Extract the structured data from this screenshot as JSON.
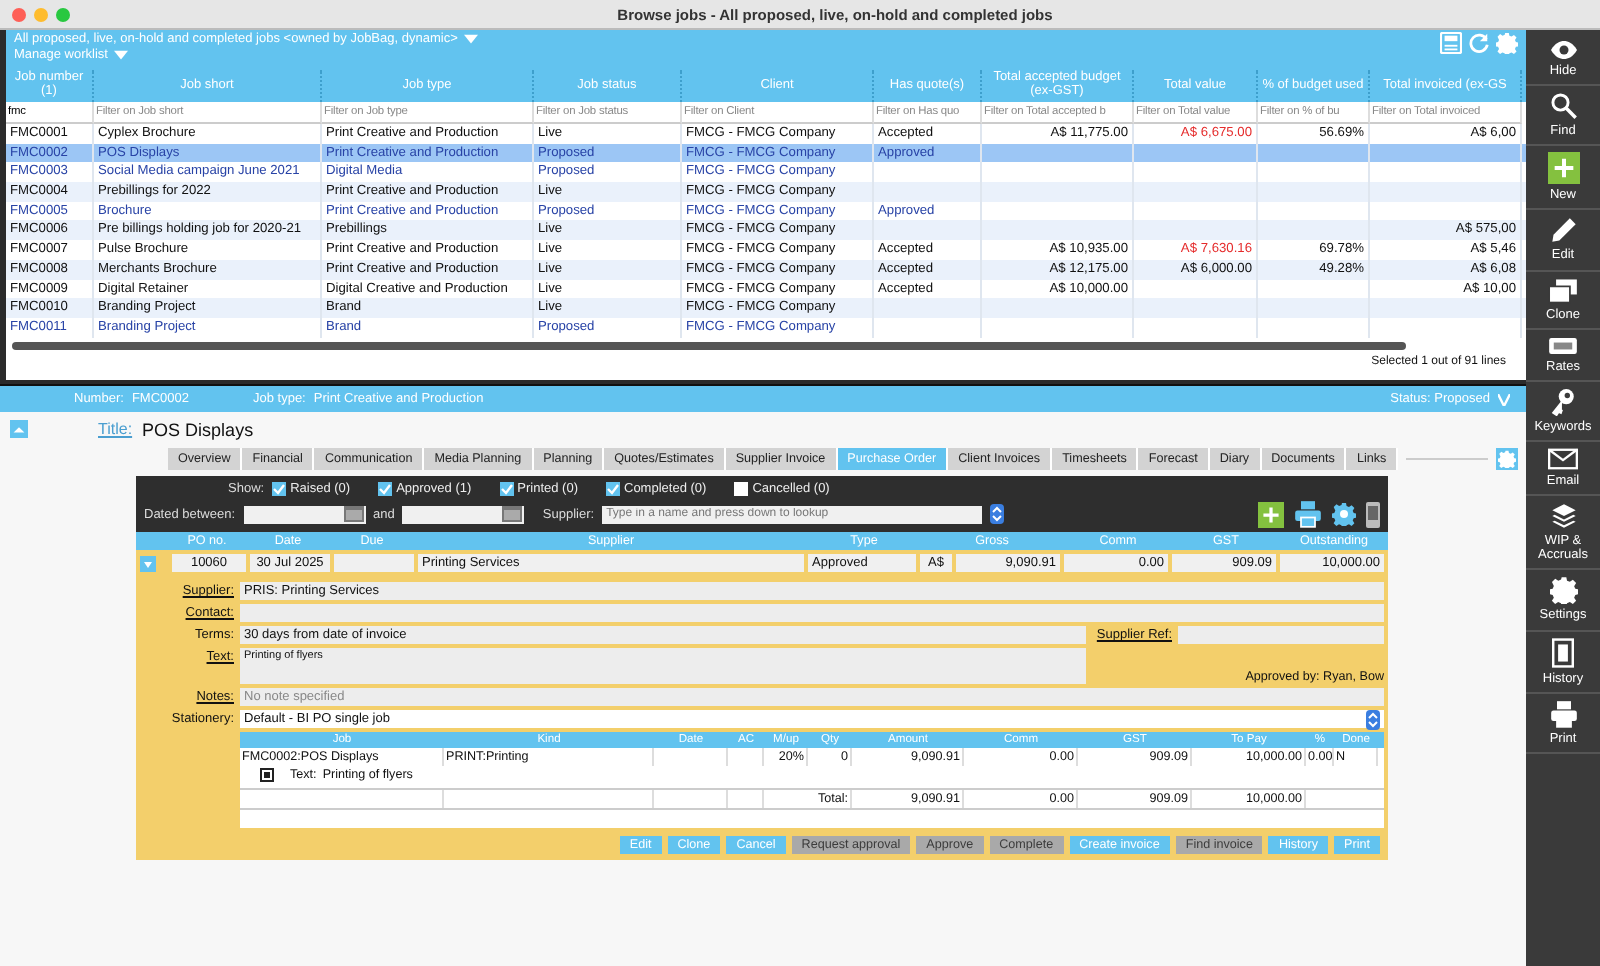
{
  "window": {
    "title": "Browse jobs - All proposed, live, on-hold and completed jobs"
  },
  "job_list": {
    "filter_title": "All proposed, live, on-hold and completed jobs <owned by JobBag, dynamic>",
    "manage_label": "Manage worklist",
    "columns": [
      "Job number (1)",
      "Job short",
      "Job type",
      "Job status",
      "Client",
      "Has quote(s)",
      "Total accepted budget (ex-GST)",
      "Total value",
      "% of budget used",
      "Total invoiced (ex-GS"
    ],
    "filters": [
      {
        "value": "fmc"
      },
      {
        "placeholder": "Filter on Job short"
      },
      {
        "placeholder": "Filter on Job type"
      },
      {
        "placeholder": "Filter on Job status"
      },
      {
        "placeholder": "Filter on Client"
      },
      {
        "placeholder": "Filter on Has quo"
      },
      {
        "placeholder": "Filter on Total accepted b"
      },
      {
        "placeholder": "Filter on Total value"
      },
      {
        "placeholder": "Filter on % of bu"
      },
      {
        "placeholder": "Filter on Total invoiced"
      }
    ],
    "rows": [
      {
        "kind": "live",
        "selected": false,
        "over_budget": true,
        "number": "FMC0001",
        "short": "Cyplex Brochure",
        "type": "Print Creative and Production",
        "status": "Live",
        "client": "FMCG - FMCG Company",
        "quote": "Accepted",
        "budget": "A$ 11,775.00",
        "value": "A$ 6,675.00",
        "pct": "56.69%",
        "invoiced": "A$ 6,00"
      },
      {
        "kind": "proposed",
        "selected": true,
        "number": "FMC0002",
        "short": "POS Displays",
        "type": "Print Creative and Production",
        "status": "Proposed",
        "client": "FMCG - FMCG Company",
        "quote": "Approved"
      },
      {
        "kind": "proposed",
        "selected": false,
        "number": "FMC0003",
        "short": "Social Media campaign June 2021",
        "type": "Digital Media",
        "status": "Proposed",
        "client": "FMCG - FMCG Company"
      },
      {
        "kind": "live",
        "selected": false,
        "number": "FMC0004",
        "short": "Prebillings for 2022",
        "type": "Print Creative and Production",
        "status": "Live",
        "client": "FMCG - FMCG Company"
      },
      {
        "kind": "proposed",
        "selected": false,
        "number": "FMC0005",
        "short": "Brochure",
        "type": "Print Creative and Production",
        "status": "Proposed",
        "client": "FMCG - FMCG Company",
        "quote": "Approved"
      },
      {
        "kind": "live",
        "selected": false,
        "number": "FMC0006",
        "short": "Pre billings holding job for 2020-21",
        "type": "Prebillings",
        "status": "Live",
        "client": "FMCG - FMCG Company",
        "invoiced": "A$ 575,00"
      },
      {
        "kind": "live",
        "selected": false,
        "over_budget": true,
        "number": "FMC0007",
        "short": "Pulse Brochure",
        "type": "Print Creative and Production",
        "status": "Live",
        "client": "FMCG - FMCG Company",
        "quote": "Accepted",
        "budget": "A$ 10,935.00",
        "value": "A$ 7,630.16",
        "pct": "69.78%",
        "invoiced": "A$ 5,46"
      },
      {
        "kind": "live",
        "selected": false,
        "over_budget": false,
        "number": "FMC0008",
        "short": "Merchants Brochure",
        "type": "Print Creative and Production",
        "status": "Live",
        "client": "FMCG - FMCG Company",
        "quote": "Accepted",
        "budget": "A$ 12,175.00",
        "value": "A$ 6,000.00",
        "pct": "49.28%",
        "invoiced": "A$ 6,08"
      },
      {
        "kind": "live",
        "selected": false,
        "number": "FMC0009",
        "short": "Digital Retainer",
        "type": "Digital Creative and Production",
        "status": "Live",
        "client": "FMCG - FMCG Company",
        "quote": "Accepted",
        "budget": "A$ 10,000.00",
        "invoiced": "A$ 10,00"
      },
      {
        "kind": "live",
        "selected": false,
        "number": "FMC0010",
        "short": "Branding Project",
        "type": "Brand",
        "status": "Live",
        "client": "FMCG - FMCG Company"
      },
      {
        "kind": "proposed",
        "selected": false,
        "number": "FMC0011",
        "short": "Branding Project",
        "type": "Brand",
        "status": "Proposed",
        "client": "FMCG - FMCG Company"
      }
    ],
    "status": "Selected 1 out of 91 lines"
  },
  "job": {
    "number_label": "Number:",
    "number": "FMC0002",
    "type_label": "Job type:",
    "type": "Print Creative and Production",
    "status": "Status: Proposed",
    "title_label": "Title:",
    "title": "POS Displays"
  },
  "tabs": [
    {
      "label": "Overview",
      "selected": false
    },
    {
      "label": "Financial",
      "selected": false
    },
    {
      "label": "Communication",
      "selected": false
    },
    {
      "label": "Media Planning",
      "selected": false
    },
    {
      "label": "Planning",
      "selected": false
    },
    {
      "label": "Quotes/Estimates",
      "selected": false
    },
    {
      "label": "Supplier Invoice",
      "selected": false
    },
    {
      "label": "Purchase Order",
      "selected": true
    },
    {
      "label": "Client Invoices",
      "selected": false
    },
    {
      "label": "Timesheets",
      "selected": false
    },
    {
      "label": "Forecast",
      "selected": false
    },
    {
      "label": "Diary",
      "selected": false
    },
    {
      "label": "Documents",
      "selected": false
    },
    {
      "label": "Links",
      "selected": false
    }
  ],
  "po_filters": {
    "show_label": "Show:",
    "checkboxes": [
      {
        "label": "Raised (0)",
        "checked": true
      },
      {
        "label": "Approved (1)",
        "checked": true
      },
      {
        "label": "Printed (0)",
        "checked": true
      },
      {
        "label": "Completed (0)",
        "checked": true
      },
      {
        "label": "Cancelled (0)",
        "checked": false
      }
    ],
    "dated_label": "Dated between:",
    "and_label": "and",
    "supplier_label": "Supplier:",
    "supplier_placeholder": "Type in a name and press down to lookup"
  },
  "po_columns": [
    "PO no.",
    "Date",
    "Due",
    "Supplier",
    "Type",
    "Gross",
    "Comm",
    "GST",
    "Outstanding"
  ],
  "po": {
    "expanded": true,
    "number": "10060",
    "date": "30 Jul 2025",
    "supplier": "Printing Services",
    "type": "Approved",
    "currency": "A$",
    "gross": "9,090.91",
    "comm": "0.00",
    "gst": "909.09",
    "outstanding": "10,000.00",
    "supplier_label": "Supplier:",
    "supplier_value": "PRIS: Printing Services",
    "contact_label": "Contact:",
    "terms_label": "Terms:",
    "terms": "30 days from date of invoice",
    "supplier_ref_label": "Supplier Ref:",
    "text_label": "Text:",
    "text": "Printing of flyers",
    "approved_by": "Approved by: Ryan, Bow",
    "notes_label": "Notes:",
    "notes_placeholder": "No note specified",
    "stationery_label": "Stationery:",
    "stationery": "Default - BI PO single job",
    "line_columns": [
      "Job",
      "Kind",
      "Date",
      "AC",
      "M/up",
      "Qty",
      "Amount",
      "Comm",
      "GST",
      "To Pay",
      "%",
      "Done"
    ],
    "lines": [
      {
        "job": "FMC0002:POS Displays",
        "kind": "PRINT:Printing",
        "markup": "20%",
        "qty": "0",
        "amount": "9,090.91",
        "comm": "0.00",
        "gst": "909.09",
        "to_pay": "10,000.00",
        "pct": "0.00",
        "done": "N",
        "text_label": "Text:",
        "text": "Printing of flyers"
      }
    ],
    "total": {
      "label": "Total:",
      "amount": "9,090.91",
      "comm": "0.00",
      "gst": "909.09",
      "to_pay": "10,000.00"
    }
  },
  "actions": [
    {
      "label": "Edit",
      "disabled": false
    },
    {
      "label": "Clone",
      "disabled": false
    },
    {
      "label": "Cancel",
      "disabled": false
    },
    {
      "label": "Request approval",
      "disabled": true
    },
    {
      "label": "Approve",
      "disabled": true
    },
    {
      "label": "Complete",
      "disabled": true
    },
    {
      "label": "Create invoice",
      "disabled": false
    },
    {
      "label": "Find invoice",
      "disabled": true
    },
    {
      "label": "History",
      "disabled": false
    },
    {
      "label": "Print",
      "disabled": false
    }
  ],
  "sidebar": [
    {
      "kind": "eye",
      "label": "Hide"
    },
    {
      "kind": "search",
      "label": "Find"
    },
    {
      "kind": "plus",
      "label": "New"
    },
    {
      "kind": "pencil",
      "label": "Edit"
    },
    {
      "kind": "clone",
      "label": "Clone"
    },
    {
      "kind": "card",
      "label": "Rates"
    },
    {
      "kind": "key",
      "label": "Keywords"
    },
    {
      "kind": "envelope",
      "label": "Email"
    },
    {
      "kind": "layers",
      "label": "WIP & Accruals"
    },
    {
      "kind": "gear",
      "label": "Settings"
    },
    {
      "kind": "document",
      "label": "History"
    },
    {
      "kind": "printer",
      "label": "Print"
    }
  ]
}
